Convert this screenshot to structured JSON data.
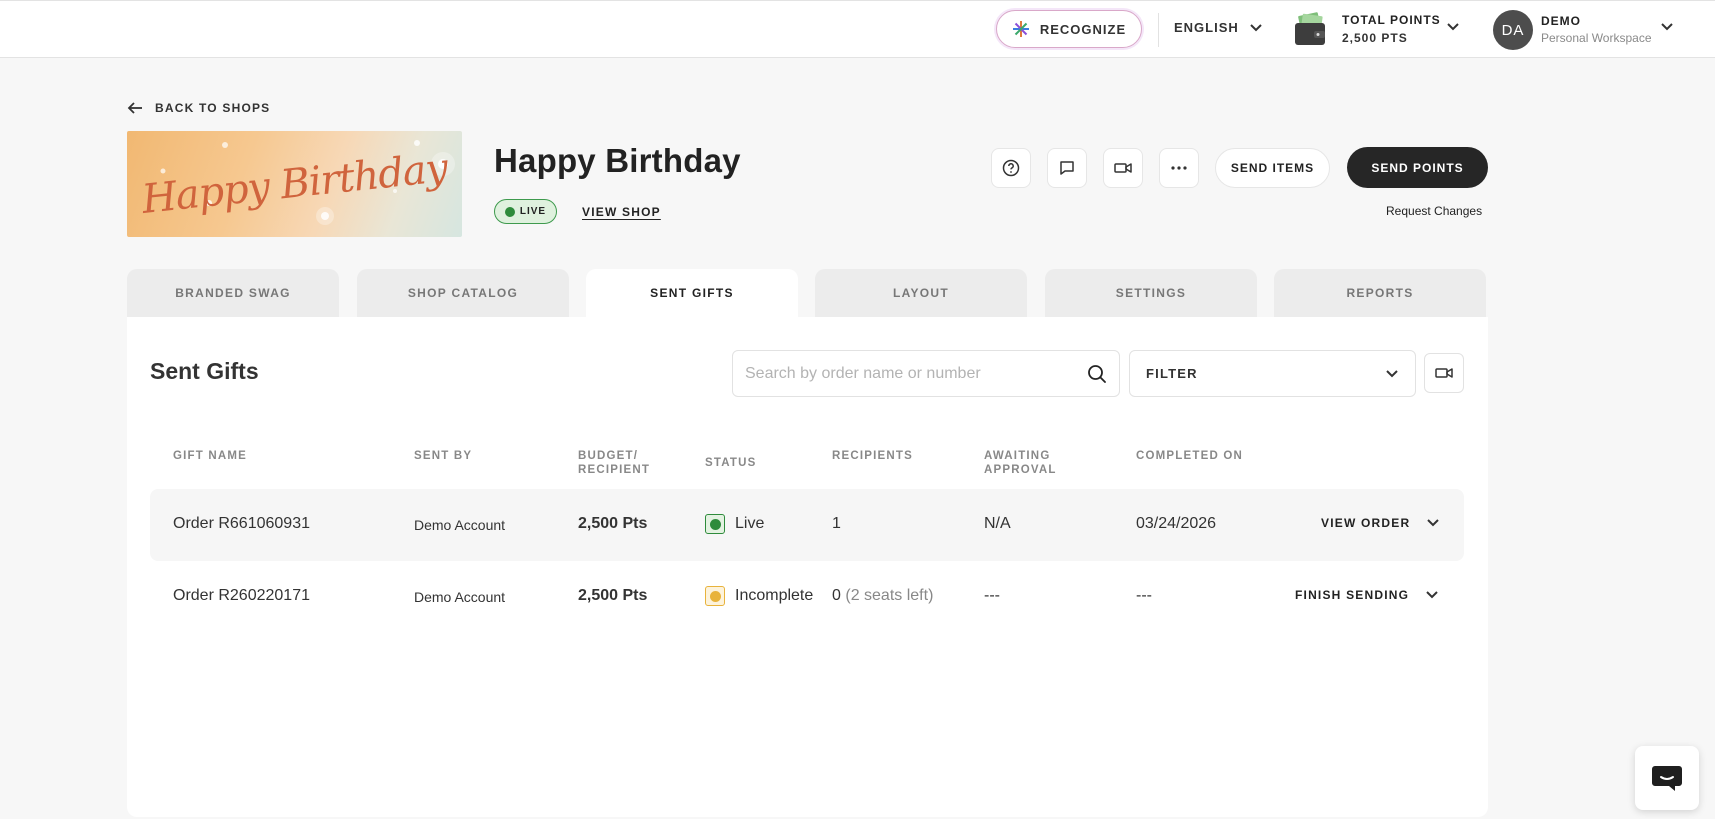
{
  "topbar": {
    "recognize_label": "RECOGNIZE",
    "language": "ENGLISH",
    "points_title": "TOTAL POINTS",
    "points_value": "2,500 PTS",
    "avatar_initials": "DA",
    "user_name": "DEMO",
    "workspace": "Personal Workspace"
  },
  "header": {
    "back_label": "BACK TO SHOPS",
    "banner_text": "Happy Birthday",
    "title": "Happy Birthday",
    "status_badge": "LIVE",
    "view_shop": "VIEW SHOP",
    "send_items": "SEND ITEMS",
    "send_points": "SEND POINTS",
    "request_changes": "Request Changes"
  },
  "tabs": [
    "BRANDED SWAG",
    "SHOP CATALOG",
    "SENT GIFTS",
    "LAYOUT",
    "SETTINGS",
    "REPORTS"
  ],
  "active_tab": "SENT GIFTS",
  "panel": {
    "title": "Sent Gifts",
    "search_placeholder": "Search by order name or number",
    "filter_label": "FILTER"
  },
  "table": {
    "headers": {
      "gift_name": "GIFT NAME",
      "sent_by": "SENT BY",
      "budget_1": "BUDGET/",
      "budget_2": "RECIPIENT",
      "status": "STATUS",
      "recipients": "RECIPIENTS",
      "awaiting_1": "AWAITING",
      "awaiting_2": "APPROVAL",
      "completed_on": "COMPLETED ON"
    },
    "rows": [
      {
        "gift_name": "Order R661060931",
        "sent_by": "Demo Account",
        "budget": "2,500 Pts",
        "status": "Live",
        "status_color": "#2e8b3b",
        "recipients": "1",
        "recipients_note": "",
        "awaiting": "N/A",
        "completed_on": "03/24/2026",
        "action": "VIEW ORDER"
      },
      {
        "gift_name": "Order R260220171",
        "sent_by": "Demo Account",
        "budget": "2,500 Pts",
        "status": "Incomplete",
        "status_color": "#e8b33c",
        "recipients": "0",
        "recipients_note": "(2 seats left)",
        "awaiting": "---",
        "completed_on": "---",
        "action": "FINISH SENDING"
      }
    ]
  },
  "colors": {
    "primary_dark": "#262626",
    "live_green": "#2e8b3b",
    "incomplete_yellow": "#e8b33c"
  }
}
